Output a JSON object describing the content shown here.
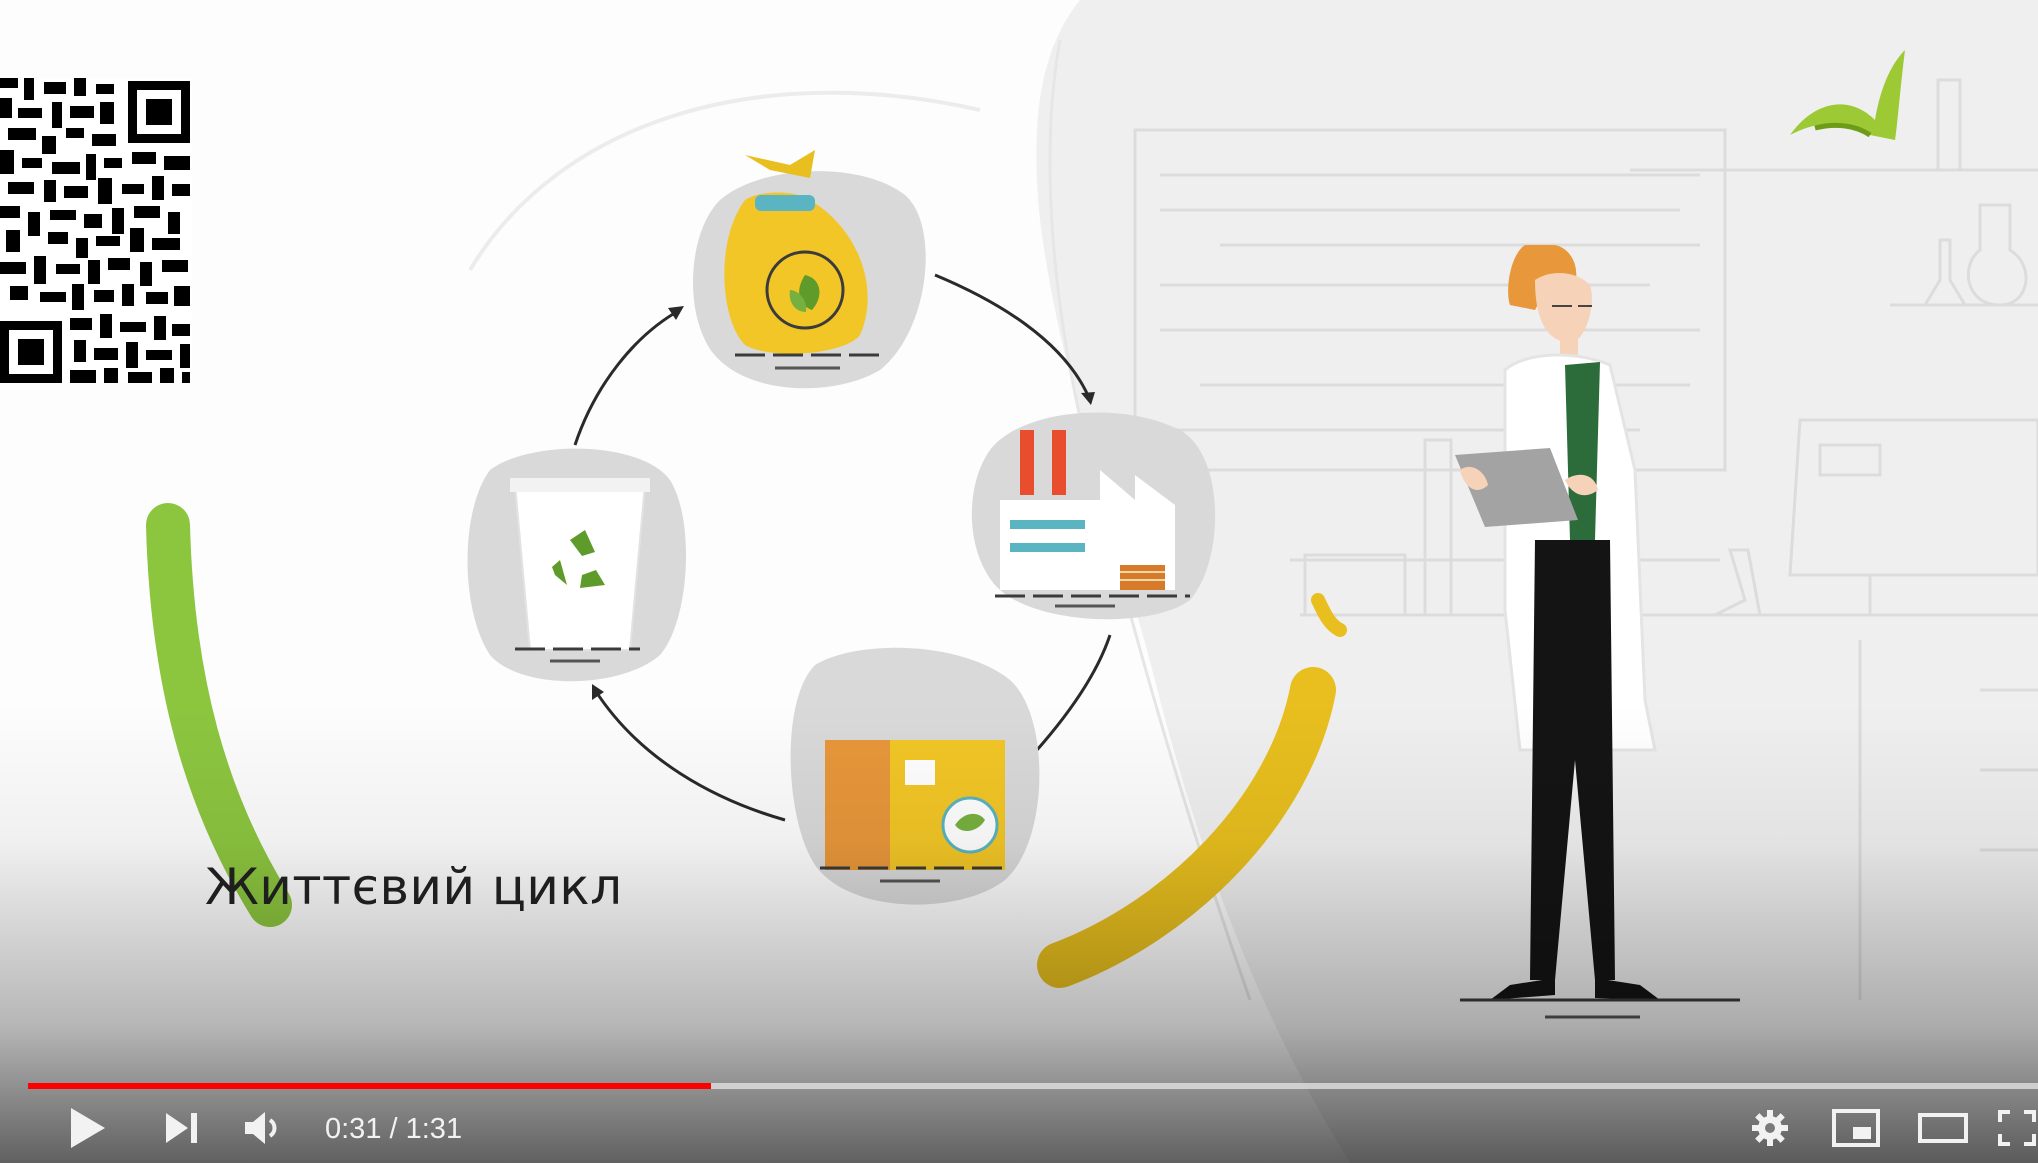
{
  "video": {
    "caption": "Життєвий цикл"
  },
  "player": {
    "current_time": "0:31",
    "separator": " / ",
    "duration": "1:31",
    "progress_fraction": 0.34,
    "accent_color": "#ff0000"
  },
  "icons": {
    "play": "play-icon",
    "next": "next-icon",
    "volume": "volume-icon",
    "settings": "gear-icon",
    "miniplayer": "miniplayer-icon",
    "theater": "theater-icon",
    "fullscreen": "fullscreen-icon"
  }
}
